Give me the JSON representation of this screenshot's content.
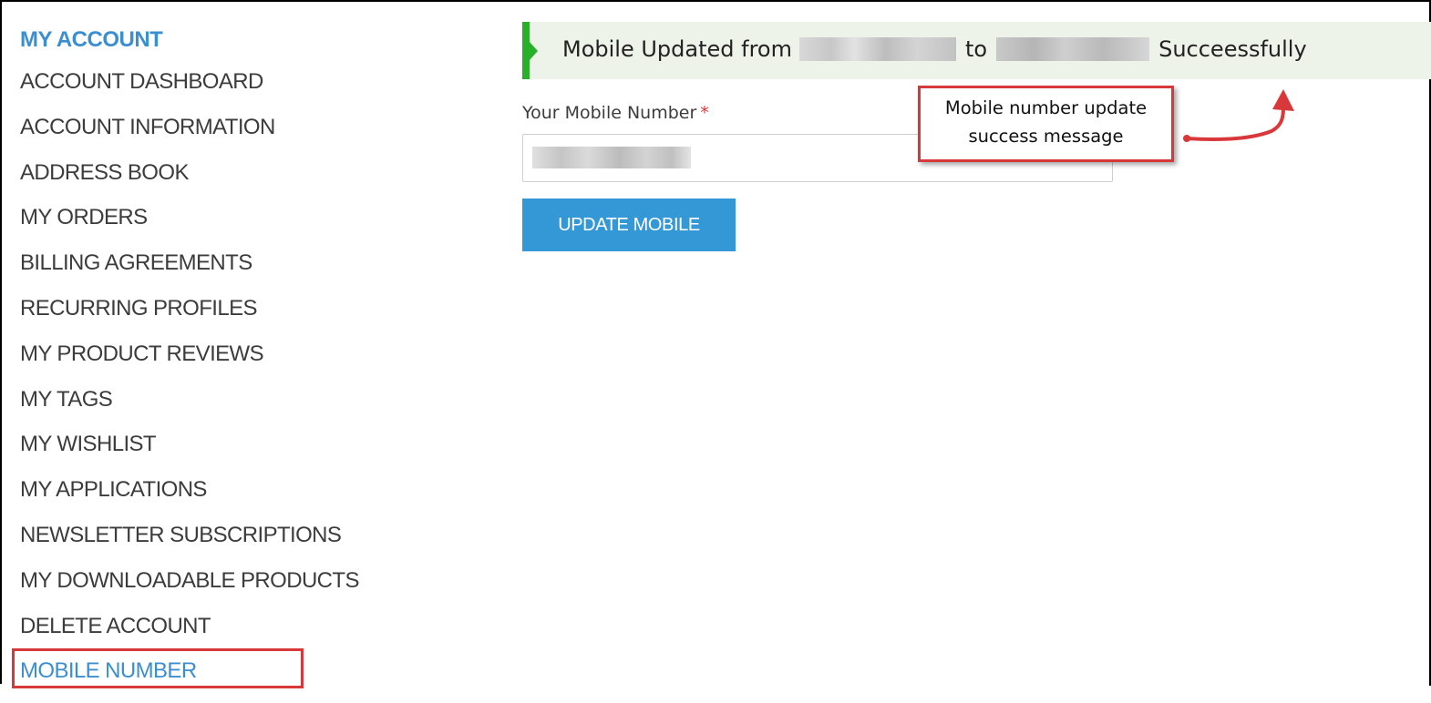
{
  "sidebar": {
    "heading": "MY ACCOUNT",
    "items": [
      "ACCOUNT DASHBOARD",
      "ACCOUNT INFORMATION",
      "ADDRESS BOOK",
      "MY ORDERS",
      "BILLING AGREEMENTS",
      "RECURRING PROFILES",
      "MY PRODUCT REVIEWS",
      "MY TAGS",
      "MY WISHLIST",
      "MY APPLICATIONS",
      "NEWSLETTER SUBSCRIPTIONS",
      "MY DOWNLOADABLE PRODUCTS",
      "DELETE ACCOUNT",
      "MOBILE NUMBER"
    ],
    "active_item": "MOBILE NUMBER"
  },
  "message": {
    "prefix": "Mobile Updated from",
    "middle": "to",
    "suffix": "Succeessfully"
  },
  "form": {
    "label": "Your Mobile Number",
    "required_mark": "*",
    "button_label": "UPDATE MOBILE"
  },
  "annotation": {
    "text_line1": "Mobile number update",
    "text_line2": "success message"
  },
  "colors": {
    "accent": "#3b8fd0",
    "button": "#3598d6",
    "success_bar": "#29b02b",
    "annotation": "#d9383a"
  }
}
